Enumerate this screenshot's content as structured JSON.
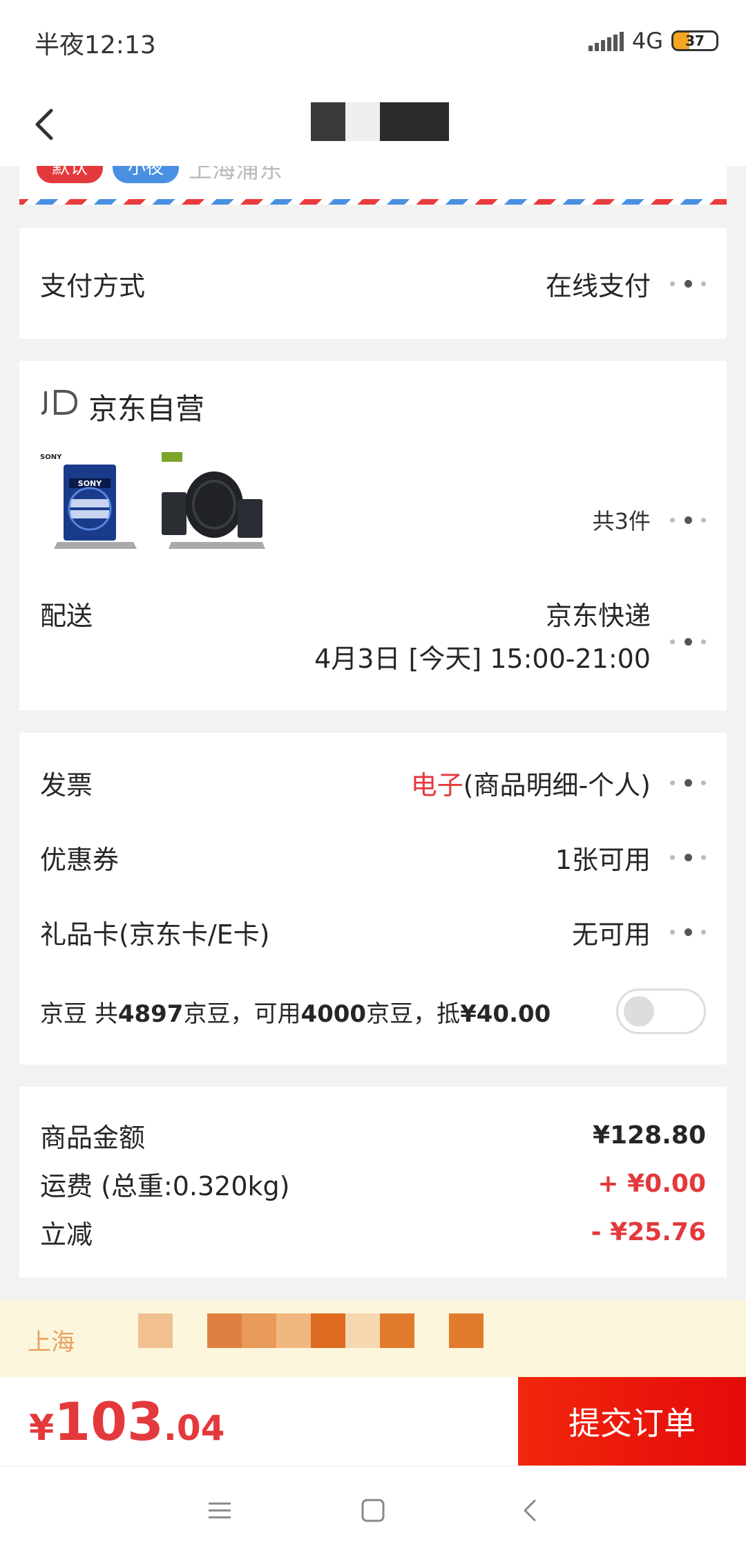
{
  "status_bar": {
    "time": "半夜12:13",
    "network": "4G",
    "battery_level": "37"
  },
  "address": {
    "tags": [
      {
        "label": "默认",
        "color": "#e4393c"
      },
      {
        "label": "小夜",
        "color": "#4a90e2"
      }
    ],
    "text": "上海浦东"
  },
  "payment": {
    "label": "支付方式",
    "value": "在线支付"
  },
  "store": {
    "name": "京东自营",
    "item_count": "共3件",
    "delivery_label": "配送",
    "delivery_method": "京东快递",
    "delivery_time": "4月3日 [今天] 15:00-21:00"
  },
  "benefits": {
    "invoice_label": "发票",
    "invoice_type": "电子",
    "invoice_detail": "(商品明细-个人)",
    "coupon_label": "优惠券",
    "coupon_value": "1张可用",
    "giftcard_label": "礼品卡(京东卡/E卡)",
    "giftcard_value": "无可用",
    "beans_label": "京豆",
    "beans_prefix": "共",
    "beans_total": "4897",
    "beans_mid": "京豆，可用",
    "beans_usable": "4000",
    "beans_suffix": "京豆，抵",
    "beans_deduct": "¥40.00",
    "beans_enabled": false
  },
  "amounts": {
    "subtotal_label": "商品金额",
    "subtotal_value": "¥128.80",
    "shipping_label": "运费 (总重:0.320kg)",
    "shipping_value": "+ ¥0.00",
    "discount_label": "立减",
    "discount_value": "- ¥25.76"
  },
  "notice": {
    "text": "上海"
  },
  "checkout": {
    "currency": "¥",
    "total_int": "103",
    "total_dec": ".04",
    "submit_label": "提交订单"
  },
  "colors": {
    "accent_red": "#e4393c",
    "submit_red": "#f2270c",
    "notice_bg": "#fbf6dc"
  }
}
